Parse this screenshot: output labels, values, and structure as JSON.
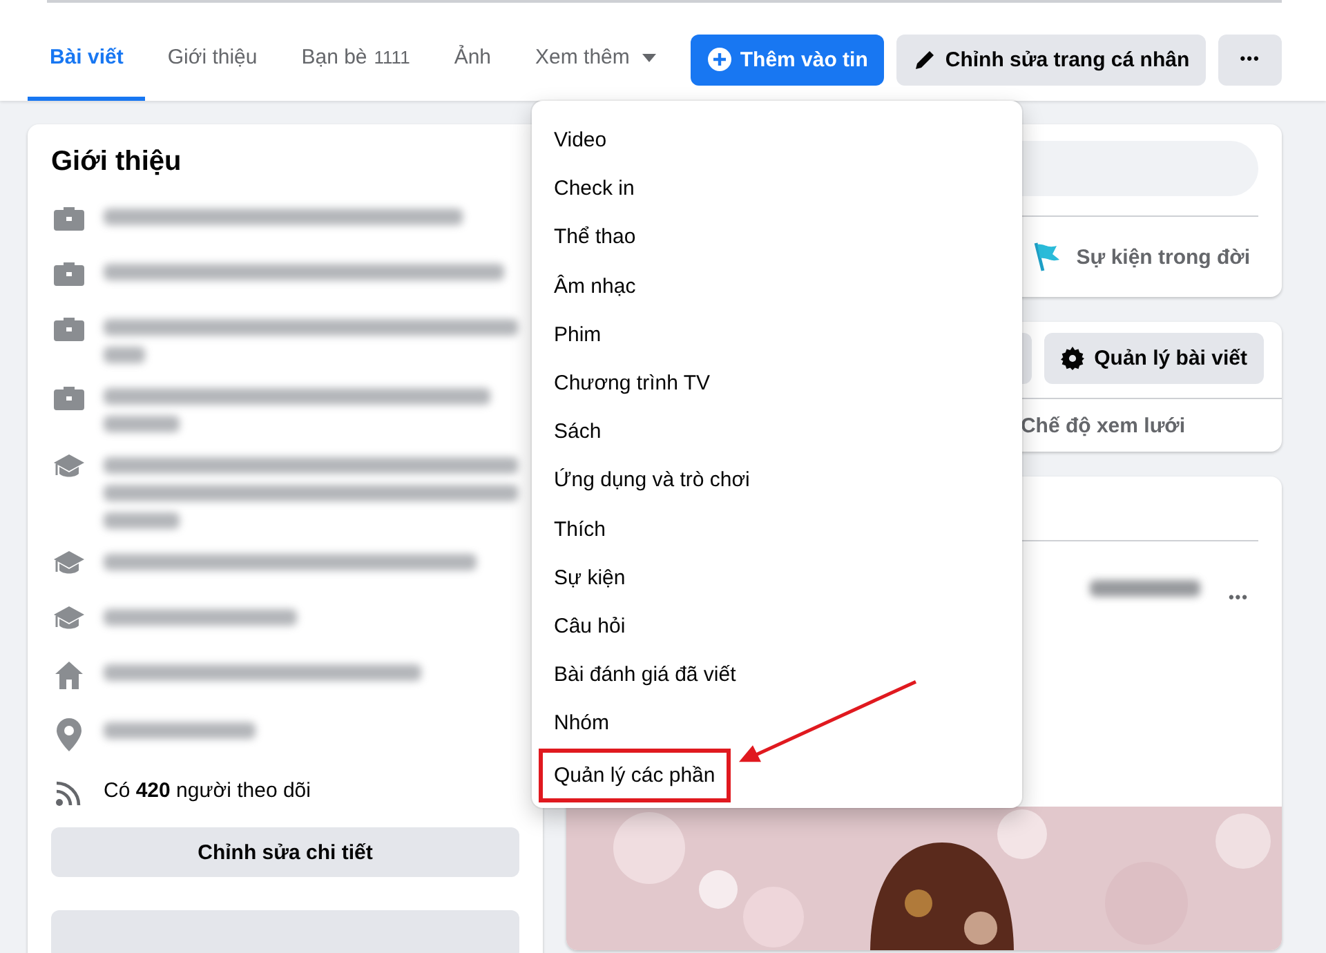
{
  "tabs": [
    {
      "label": "Bài viết",
      "selected": true
    },
    {
      "label": "Giới thiệu",
      "selected": false
    },
    {
      "label": "Bạn bè",
      "count": "1111",
      "selected": false
    },
    {
      "label": "Ảnh",
      "selected": false
    },
    {
      "label": "Xem thêm",
      "selected": false,
      "expanded": true
    }
  ],
  "actions": [
    {
      "kind": "primary",
      "label": "Thêm vào tin"
    },
    {
      "kind": "secondary",
      "label": "Chỉnh sửa trang cá nhân"
    },
    {
      "kind": "more",
      "label": "•••"
    }
  ],
  "more_menu": {
    "items": [
      {
        "label": "Video",
        "highlighted": false
      },
      {
        "label": "Check in",
        "highlighted": false
      },
      {
        "label": "Thể thao",
        "highlighted": false
      },
      {
        "label": "Âm nhạc",
        "highlighted": false
      },
      {
        "label": "Phim",
        "highlighted": false
      },
      {
        "label": "Chương trình TV",
        "highlighted": false
      },
      {
        "label": "Sách",
        "highlighted": false
      },
      {
        "label": "Ứng dụng và trò chơi",
        "highlighted": false
      },
      {
        "label": "Thích",
        "highlighted": false
      },
      {
        "label": "Sự kiện",
        "highlighted": false
      },
      {
        "label": "Câu hỏi",
        "highlighted": false
      },
      {
        "label": "Bài đánh giá đã viết",
        "highlighted": false
      },
      {
        "label": "Nhóm",
        "highlighted": false
      },
      {
        "label": "Quản lý các phần",
        "highlighted": true
      }
    ]
  },
  "intro": {
    "title": "Giới thiệu",
    "items": [
      {
        "kind": "work"
      },
      {
        "kind": "work"
      },
      {
        "kind": "work"
      },
      {
        "kind": "work"
      },
      {
        "kind": "school"
      },
      {
        "kind": "school"
      },
      {
        "kind": "school"
      },
      {
        "kind": "home"
      },
      {
        "kind": "place"
      },
      {
        "kind": "followers",
        "text": "Có **420** người theo dõi"
      }
    ],
    "button": "Chỉnh sửa chi tiết"
  },
  "composer": {
    "life_event": "Sự kiện trong đời"
  },
  "posts_toolbar": {
    "manage_button": "Quản lý bài viết",
    "view_tab": "Chế độ xem lưới"
  },
  "post": {
    "more": "•••"
  }
}
